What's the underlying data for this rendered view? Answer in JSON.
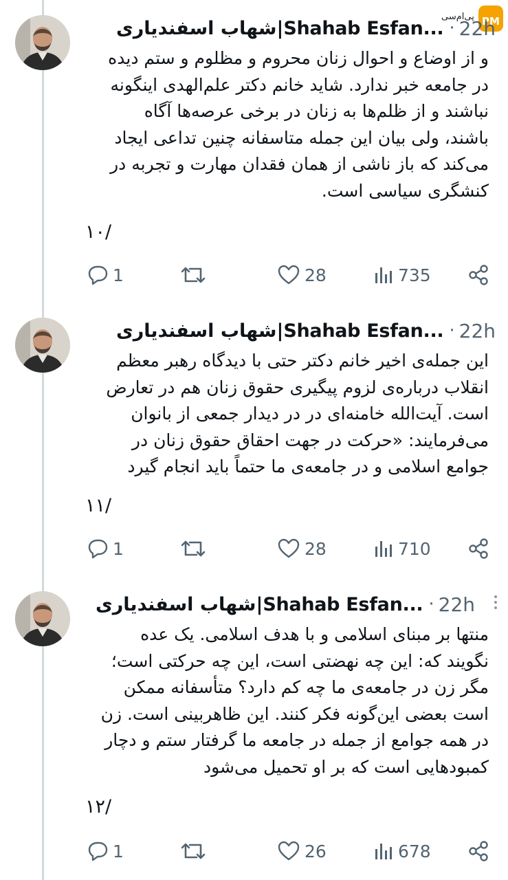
{
  "watermark": {
    "text": "پی‌ام‌سی",
    "badge": "PM"
  },
  "tweets": [
    {
      "author": "شهاب اسفندیاری|Shahab Esfan...",
      "time": "22h",
      "body": "و از اوضاع و احوال زنان محروم و مظلوم و ستم دیده\nدر جامعه خبر ندارد. شاید خانم دکتر علم‌الهدی اینگونه\nنباشند و از ظلم‌ها به زنان در برخی عرصه‌ها آگاه\nباشند، ولی بیان این جمله متاسفانه چنین تداعی ایجاد\nمی‌کند که باز ناشی از همان فقدان مهارت و تجربه در\nکنشگری سیاسی است.",
      "number": "۱۰/",
      "replies": "1",
      "retweets": "",
      "likes": "28",
      "views": "735"
    },
    {
      "author": "شهاب اسفندیاری|Shahab Esfan...",
      "time": "22h",
      "body": "این جمله‌ی اخیر خانم دکتر حتی با دیدگاه رهبر معظم\nانقلاب درباره‌ی لزوم پیگیری حقوق زنان هم در تعارض\nاست. آیت‌الله خامنه‌ای در  در دیدار جمعی از بانوان\nمی‌فرمایند: «حرکت در جهت احقاق حقوق زنان در\nجوامع اسلامی و در جامعه‌ی ما حتماً باید انجام گیرد",
      "number": "۱۱/",
      "replies": "1",
      "retweets": "",
      "likes": "28",
      "views": "710"
    },
    {
      "author": "شهاب اسفندیاری|Shahab Esfan...",
      "time": "22h",
      "body": "منتها بر مبنای اسلامی و با هدف اسلامی. یک عده\nنگویند که: این چه نهضتی است، این چه حرکتی است؛\nمگر زن در جامعه‌ی ما چه کم دارد؟ متأسفانه ممکن\nاست بعضی این‌گونه فکر کنند. این ظاهربینی است. زن\nدر همه جوامع از جمله در جامعه ما گرفتار ستم و دچار\nکمبودهایی است که بر او تحمیل می‌شود",
      "number": "۱۲/",
      "replies": "1",
      "retweets": "",
      "likes": "26",
      "views": "678"
    }
  ]
}
